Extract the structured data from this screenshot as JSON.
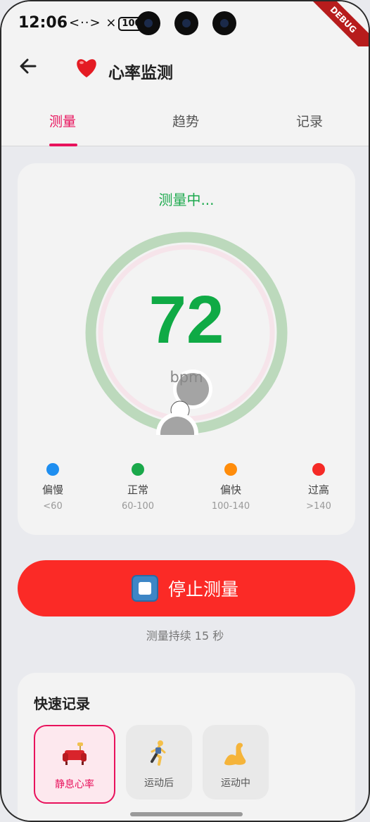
{
  "status_bar": {
    "time": "12:06",
    "icons": "<··> ×",
    "battery": "100"
  },
  "debug_banner": "DEBUG",
  "app_bar": {
    "back_icon": "arrow-left-icon",
    "heart_icon": "heart-icon",
    "title": "心率监测"
  },
  "tabs": [
    {
      "label": "测量",
      "active": true
    },
    {
      "label": "趋势",
      "active": false
    },
    {
      "label": "记录",
      "active": false
    }
  ],
  "measure_card": {
    "status": "测量中...",
    "value": "72",
    "unit": "bpm",
    "legend": [
      {
        "name": "偏慢",
        "range": "<60",
        "color": "#1e8ef0"
      },
      {
        "name": "正常",
        "range": "60-100",
        "color": "#1aa84a"
      },
      {
        "name": "偏快",
        "range": "100-140",
        "color": "#ff8c0a"
      },
      {
        "name": "过高",
        "range": ">140",
        "color": "#f52a26"
      }
    ]
  },
  "stop_button": {
    "label": "停止测量",
    "icon": "stop-icon"
  },
  "duration_text": "测量持续 15 秒",
  "quick_record": {
    "title": "快速记录",
    "items": [
      {
        "label": "静息心率",
        "emoji": "🛋",
        "active": true
      },
      {
        "label": "运动后",
        "emoji": "🏃",
        "active": false
      },
      {
        "label": "运动中",
        "emoji": "💪",
        "active": false
      }
    ]
  },
  "colors": {
    "accent": "#e8125c",
    "normal_green": "#0faa45",
    "stop_red": "#fb2a26"
  }
}
